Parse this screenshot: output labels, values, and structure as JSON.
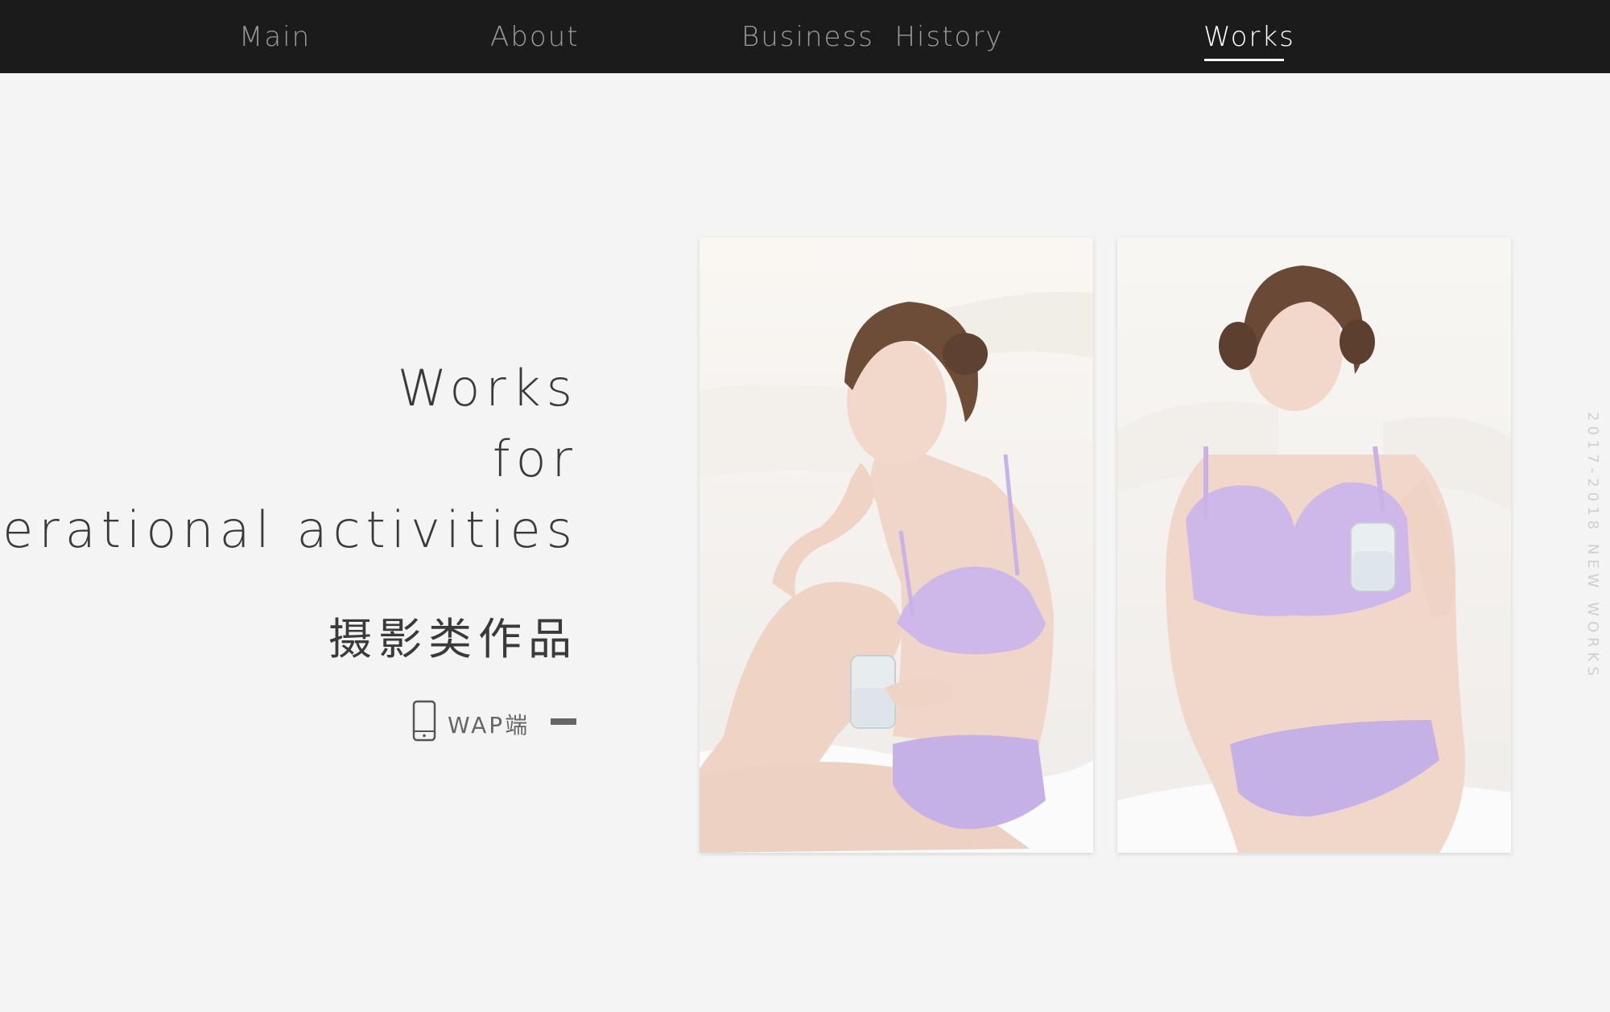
{
  "nav": {
    "items": [
      {
        "label": "Main"
      },
      {
        "label": "About"
      },
      {
        "label": "Business  History"
      },
      {
        "label": "Works",
        "active": true
      }
    ]
  },
  "hero": {
    "line1": "Works",
    "line2": "for",
    "line3": "Operational activities",
    "cn_title": "摄影类作品",
    "wap_label": "WAP端"
  },
  "side_text": "2017-2018 NEW WORKS",
  "colors": {
    "nav_bg": "#1b1b1b",
    "page_bg": "#f4f4f4",
    "accent_lilac": "#c9b6e8"
  },
  "icons": [
    "phone-icon",
    "dash-icon"
  ]
}
